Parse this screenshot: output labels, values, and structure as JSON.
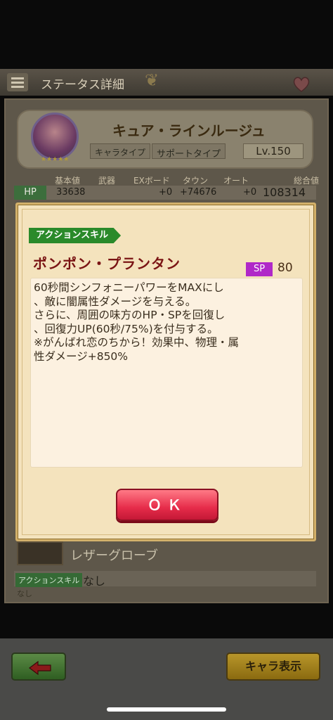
{
  "header": {
    "title": "ステータス詳細",
    "menu_icon": "hamburger-icon",
    "favorite_icon": "heart-icon"
  },
  "character": {
    "name": "キュア・ラインルージュ",
    "type_label": "キャラタイプ",
    "type_value": "サポートタイプ",
    "level": "Lv.150",
    "stars": "★★★★★"
  },
  "stats": {
    "headers": [
      "基本値",
      "武器",
      "EXボード",
      "タウン",
      "オート",
      "総合値"
    ],
    "hp": {
      "label": "HP",
      "values": [
        "33638",
        "",
        "+0",
        "+74676",
        "+0",
        "108314"
      ]
    }
  },
  "equipment": {
    "name": "レザーグローブ",
    "skill_label": "アクションスキル",
    "skill_value": "なし",
    "sub": "なし"
  },
  "dialog": {
    "tag": "アクションスキル",
    "skill_name": "ポンポン・プランタン",
    "sp_label": "SP",
    "sp_value": "80",
    "description": [
      "60秒間シンフォニーパワーをMAXにし",
      "、敵に闇属性ダメージを与える。",
      "さらに、周囲の味方のHP・SPを回復し",
      "、回復力UP(60秒/75%)を付与する。",
      "※がんばれ恋のちから！効果中、物理・属",
      "性ダメージ+850%"
    ],
    "ok_label": "ＯＫ"
  },
  "footer": {
    "back_icon": "arrow-left-icon",
    "chara_button": "キャラ表示"
  },
  "colors": {
    "ok_red": "#e62c4a",
    "skill_green": "#2a8a2a",
    "sp_purple": "#b028c8",
    "name_red": "#7a1414"
  }
}
